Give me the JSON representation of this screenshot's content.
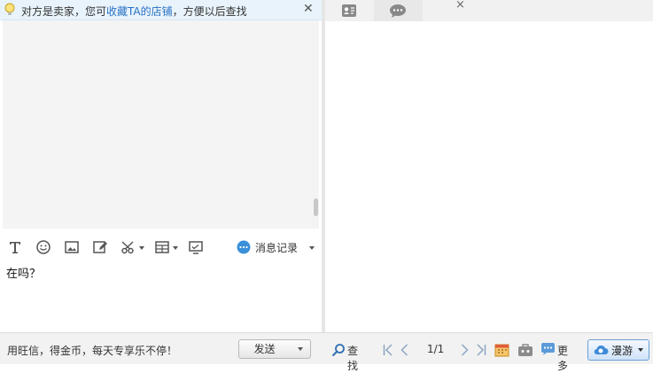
{
  "notice": {
    "prefix": "对方是卖家，您可",
    "link": "收藏TA的店铺",
    "suffix": "，方便以后查找",
    "close_glyph": "✕"
  },
  "toolbar": {
    "message_record_label": "消息记录"
  },
  "input": {
    "text": "在吗？"
  },
  "tabs": {
    "chat_close_glyph": "×"
  },
  "bottom": {
    "promo_text": "用旺信，得金币，每天专享乐不停！",
    "send_label": "发送",
    "find_label": "查找",
    "page_indicator": "1/1",
    "more_label": "更多",
    "roam_label": "漫游"
  },
  "colors": {
    "notice_bg": "#e8f3fb",
    "link": "#2a72c4",
    "roam_accent": "#6a9fd6"
  }
}
